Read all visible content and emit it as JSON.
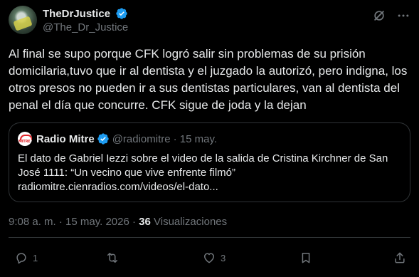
{
  "author": {
    "display_name": "TheDrJustice",
    "handle": "@The_Dr_Justice",
    "verified": true
  },
  "header_icons": [
    "grok-icon",
    "more-icon"
  ],
  "body": "Al final se supo porque CFK logró salir sin problemas de su prisión domicilaria,tuvo que ir al dentista y el juzgado la autorizó, pero indigna, los otros presos no pueden ir a sus dentistas particulares, van al dentista del penal el día que concurre. CFK sigue de joda y la dejan",
  "quote": {
    "name": "Radio Mitre",
    "handle": "@radiomitre",
    "date": "· 15 may.",
    "text": "El dato de Gabriel Iezzi sobre el video de la salida de Cristina Kirchner de San José 1111: “Un vecino que vive enfrente filmó”",
    "link": "radiomitre.cienradios.com/videos/el-dato..."
  },
  "meta": {
    "time": "9:08 a. m. · 15 may. 2026 ·",
    "views_count": "36",
    "views_label": "Visualizaciones"
  },
  "actions": {
    "reply_count": "1",
    "retweet_count": "",
    "like_count": "3"
  },
  "colors": {
    "background": "#000000",
    "text": "#e7e9ea",
    "muted": "#71767b",
    "border": "#2f3336",
    "verified": "#1d9bf0"
  }
}
